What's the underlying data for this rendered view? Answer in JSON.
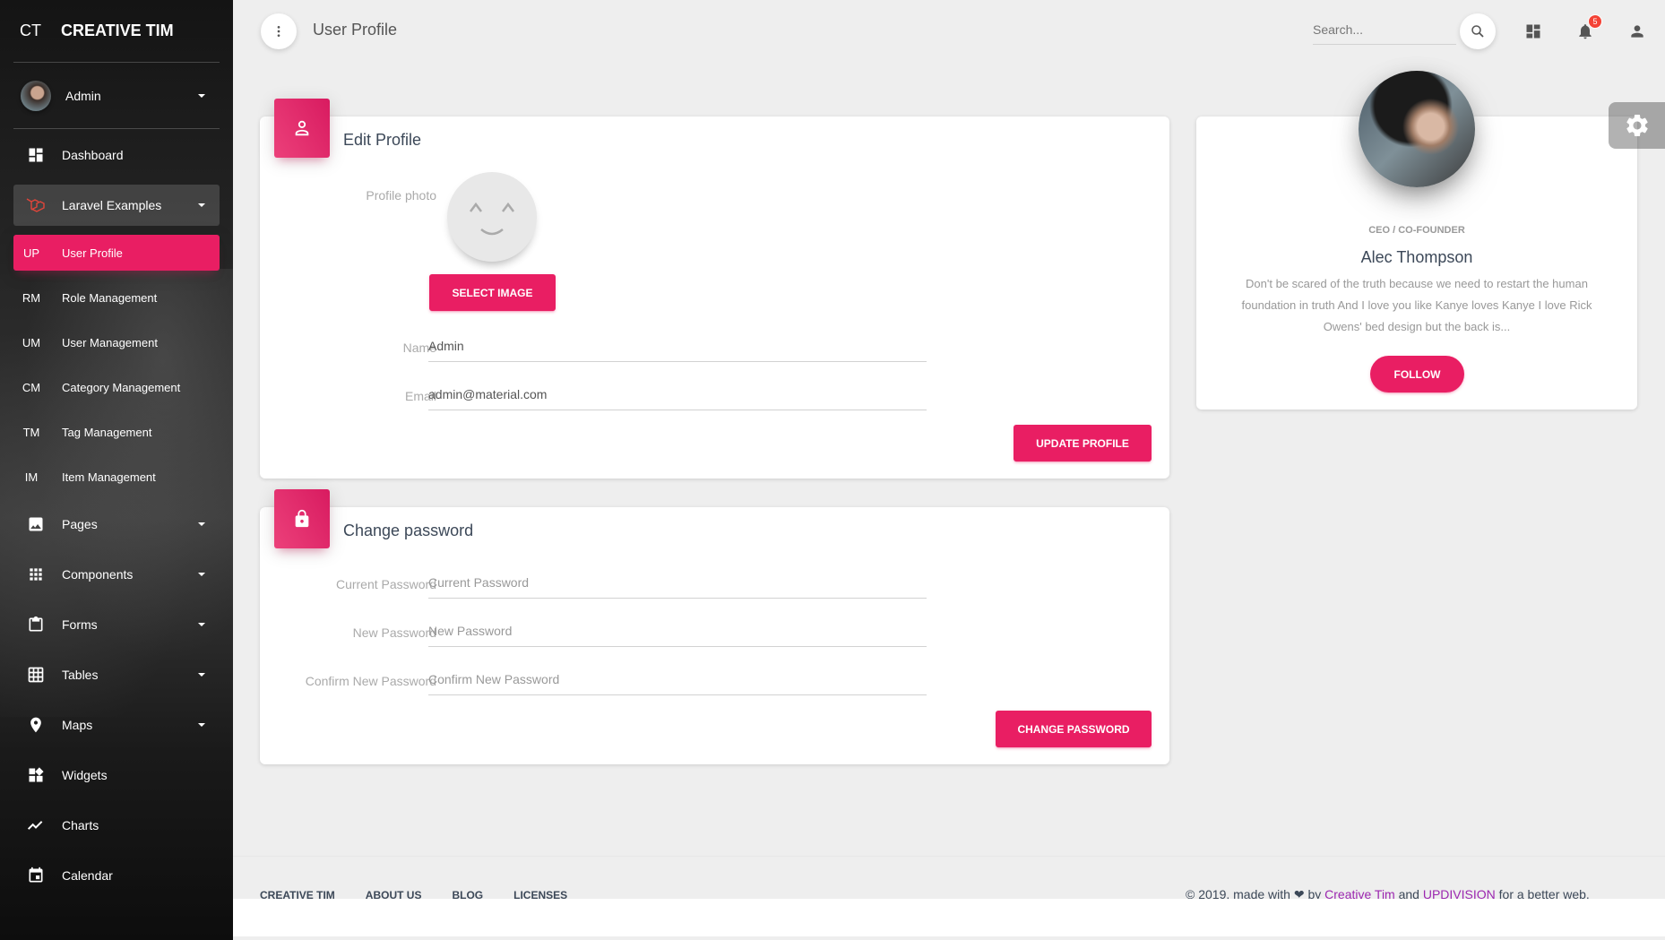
{
  "sidebar": {
    "logo_mini": "CT",
    "logo_full": "CREATIVE TIM",
    "user_name": "Admin",
    "items": [
      {
        "label": "Dashboard",
        "icon": "dashboard-icon"
      },
      {
        "label": "Laravel Examples",
        "icon": "laravel-icon"
      },
      {
        "label": "Pages",
        "icon": "image-icon"
      },
      {
        "label": "Components",
        "icon": "apps-icon"
      },
      {
        "label": "Forms",
        "icon": "clipboard-icon"
      },
      {
        "label": "Tables",
        "icon": "grid-icon"
      },
      {
        "label": "Maps",
        "icon": "place-icon"
      },
      {
        "label": "Widgets",
        "icon": "widgets-icon"
      },
      {
        "label": "Charts",
        "icon": "timeline-icon"
      },
      {
        "label": "Calendar",
        "icon": "calendar-icon"
      }
    ],
    "subitems": [
      {
        "mini": "UP",
        "label": "User Profile"
      },
      {
        "mini": "RM",
        "label": "Role Management"
      },
      {
        "mini": "UM",
        "label": "User Management"
      },
      {
        "mini": "CM",
        "label": "Category Management"
      },
      {
        "mini": "TM",
        "label": "Tag Management"
      },
      {
        "mini": "IM",
        "label": "Item Management"
      }
    ]
  },
  "topbar": {
    "title": "User Profile",
    "search_placeholder": "Search...",
    "notification_count": "5"
  },
  "edit_profile": {
    "title": "Edit Profile",
    "photo_label": "Profile photo",
    "select_image": "Select image",
    "name_label": "Name",
    "name_value": "Admin",
    "email_label": "Email",
    "email_value": "admin@material.com",
    "update_button": "Update Profile"
  },
  "change_password": {
    "title": "Change password",
    "current_label": "Current Password",
    "current_placeholder": "Current Password",
    "new_label": "New Password",
    "new_placeholder": "New Password",
    "confirm_label": "Confirm New Password",
    "confirm_placeholder": "Confirm New Password",
    "button": "Change password"
  },
  "profile_card": {
    "job_title": "CEO / CO-FOUNDER",
    "name": "Alec Thompson",
    "description": "Don't be scared of the truth because we need to restart the human foundation in truth And I love you like Kanye loves Kanye I love Rick Owens' bed design but the back is...",
    "follow": "Follow"
  },
  "footer": {
    "links": [
      "CREATIVE TIM",
      "ABOUT US",
      "BLOG",
      "LICENSES"
    ],
    "copyright_prefix": "© 2019, made with",
    "by": "by",
    "creative_tim": "Creative Tim",
    "and": "and",
    "updivision": "UPDIVISION",
    "suffix": "for a better web."
  },
  "colors": {
    "primary": "#e91e63",
    "link": "#9c27b0"
  }
}
